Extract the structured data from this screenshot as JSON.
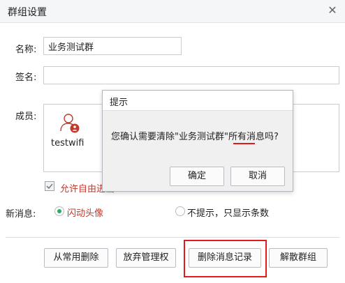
{
  "window": {
    "title": "群组设置",
    "close_icon": "close-icon"
  },
  "form": {
    "name_label": "名称:",
    "name_value": "业务测试群",
    "signature_label": "签名:",
    "signature_value": "",
    "members_label": "成员:",
    "members": [
      {
        "name": "testwifi",
        "icon": "user-admin-icon"
      }
    ],
    "checkbox_label": "允许自由进出",
    "new_message_label": "新消息:",
    "radio_flash_label": "闪动头像",
    "radio_no_prompt_label": "不提示，只显示条数"
  },
  "buttons": {
    "remove_common": "从常用删除",
    "give_up_admin": "放弃管理权",
    "delete_records": "删除消息记录",
    "dissolve": "解散群组"
  },
  "dialog": {
    "title": "提示",
    "message": "您确认需要清除\"业务测试群\"所有消息吗?",
    "ok": "确定",
    "cancel": "取消"
  },
  "colors": {
    "highlight": "#e01b1b",
    "radio_selected": "#27ae60",
    "checkbox_label": "#c0392b",
    "admin_badge": "#c0392b"
  }
}
